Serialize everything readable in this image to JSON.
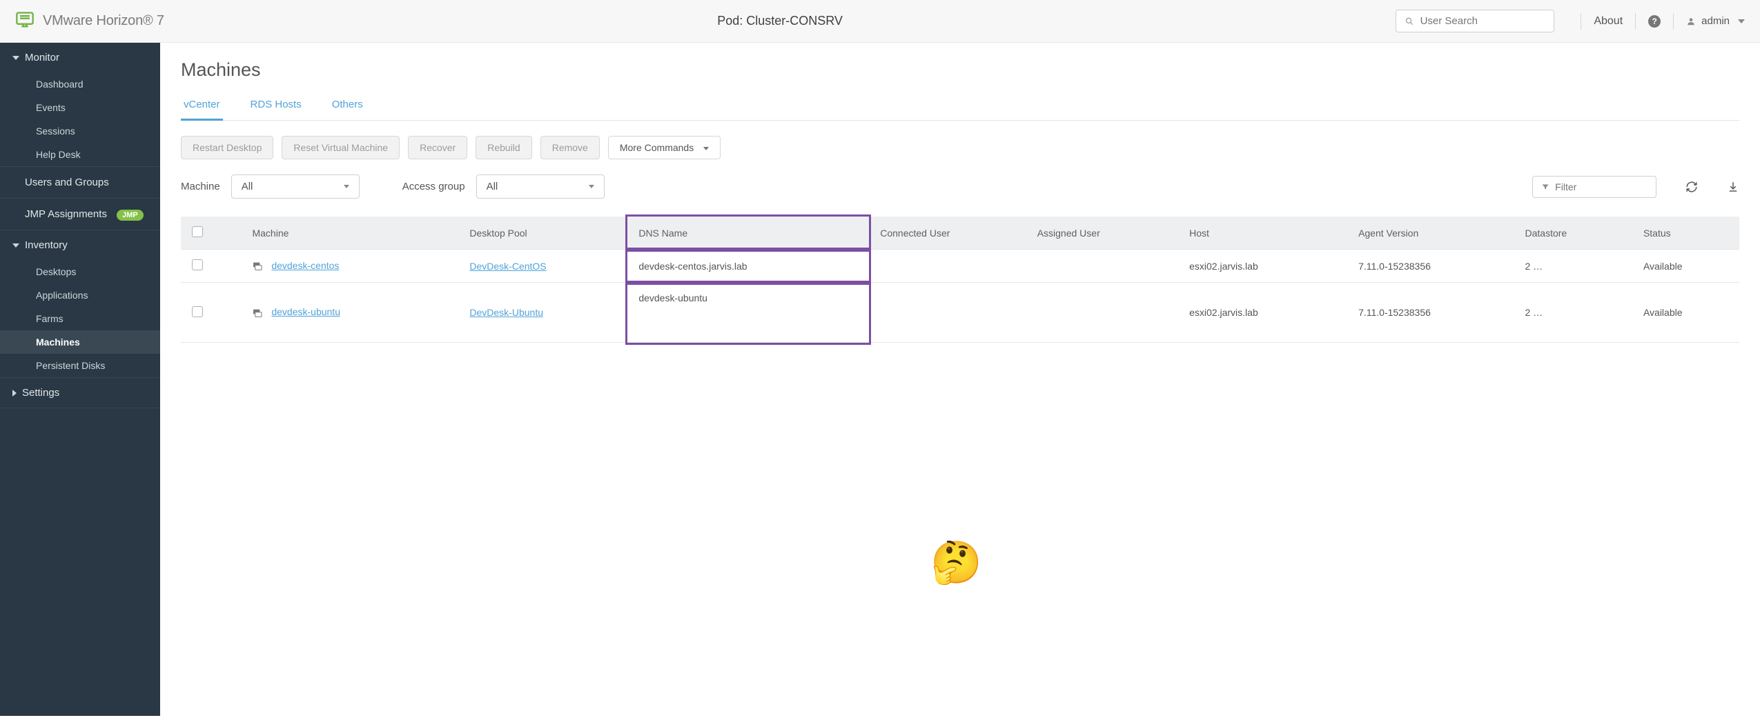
{
  "header": {
    "product": "VMware Horizon® 7",
    "pod_label": "Pod: Cluster-CONSRV",
    "search_placeholder": "User Search",
    "about": "About",
    "user": "admin"
  },
  "sidebar": {
    "monitor": {
      "label": "Monitor",
      "items": [
        "Dashboard",
        "Events",
        "Sessions",
        "Help Desk"
      ]
    },
    "users_groups": "Users and Groups",
    "jmp": {
      "label": "JMP Assignments",
      "badge": "JMP"
    },
    "inventory": {
      "label": "Inventory",
      "items": [
        "Desktops",
        "Applications",
        "Farms",
        "Machines",
        "Persistent Disks"
      ]
    },
    "settings": "Settings"
  },
  "page": {
    "title": "Machines",
    "tabs": [
      "vCenter",
      "RDS Hosts",
      "Others"
    ],
    "actions": {
      "restart": "Restart Desktop",
      "reset": "Reset Virtual Machine",
      "recover": "Recover",
      "rebuild": "Rebuild",
      "remove": "Remove",
      "more": "More Commands"
    },
    "filters": {
      "machine_label": "Machine",
      "machine_value": "All",
      "access_label": "Access group",
      "access_value": "All",
      "filter_placeholder": "Filter"
    },
    "table": {
      "headers": {
        "machine": "Machine",
        "pool": "Desktop Pool",
        "dns": "DNS Name",
        "connected": "Connected User",
        "assigned": "Assigned User",
        "host": "Host",
        "agent": "Agent Version",
        "datastore": "Datastore",
        "status": "Status"
      },
      "rows": [
        {
          "machine": "devdesk-centos",
          "pool": "DevDesk-CentOS",
          "dns": "devdesk-centos.jarvis.lab",
          "connected": "",
          "assigned": "",
          "host": "esxi02.jarvis.lab",
          "agent": "7.11.0-15238356",
          "datastore": "2 …",
          "status": "Available"
        },
        {
          "machine": "devdesk-ubuntu",
          "pool": "DevDesk-Ubuntu",
          "dns": "devdesk-ubuntu",
          "connected": "",
          "assigned": "",
          "host": "esxi02.jarvis.lab",
          "agent": "7.11.0-15238356",
          "datastore": "2 …",
          "status": "Available"
        }
      ]
    }
  },
  "overlay_emoji": "🤔"
}
